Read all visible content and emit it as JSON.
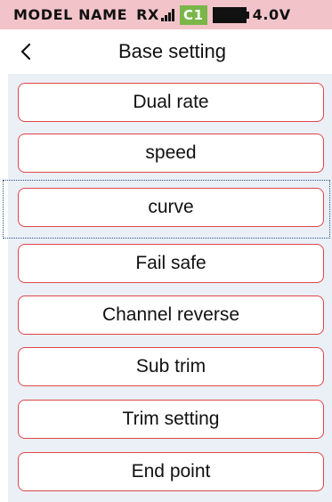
{
  "status_bar": {
    "model_name": "MODEL NAME",
    "rx_label": "RX",
    "channel": "C1",
    "voltage": "4.0V",
    "colors": {
      "background": "#f2c4c9",
      "channel_badge": "#7ab648"
    }
  },
  "header": {
    "title": "Base setting",
    "back_icon": "chevron-left-icon"
  },
  "menu": {
    "items": [
      {
        "label": "Dual rate"
      },
      {
        "label": "speed"
      },
      {
        "label": "curve"
      },
      {
        "label": "Fail safe"
      },
      {
        "label": "Channel reverse"
      },
      {
        "label": "Sub trim"
      },
      {
        "label": "Trim setting"
      },
      {
        "label": "End point"
      }
    ],
    "selected_label": "curve",
    "colors": {
      "panel": "#eaf0f6",
      "button_border": "#e0454b",
      "selection": "#2a4f8f"
    }
  }
}
